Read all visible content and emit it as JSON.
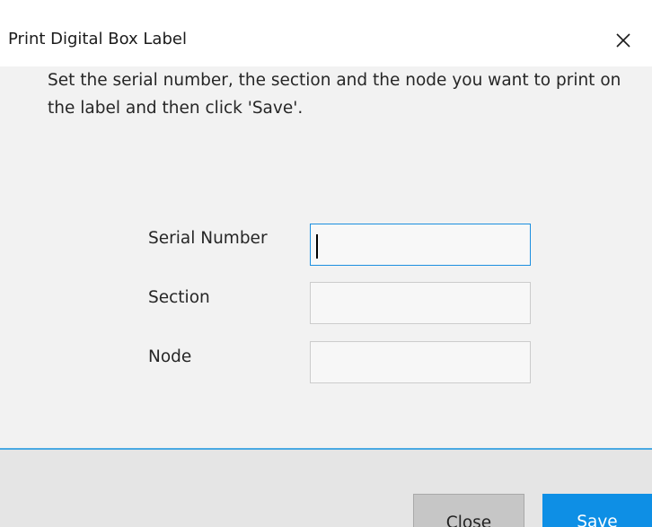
{
  "dialog": {
    "title": "Print Digital Box Label",
    "close_icon": "close-icon"
  },
  "content": {
    "instructions": "Set the serial number, the section and the node you want to print on the label and then click 'Save'.",
    "fields": [
      {
        "label": "Serial Number",
        "value": "",
        "placeholder": ""
      },
      {
        "label": "Section",
        "value": "",
        "placeholder": ""
      },
      {
        "label": "Node",
        "value": "",
        "placeholder": ""
      }
    ]
  },
  "footer": {
    "close_label": "Close",
    "save_label": "Save"
  },
  "colors": {
    "accent": "#0e8fe5",
    "focus_border": "#1c8fe0",
    "footer_line": "#4aa9e3"
  }
}
